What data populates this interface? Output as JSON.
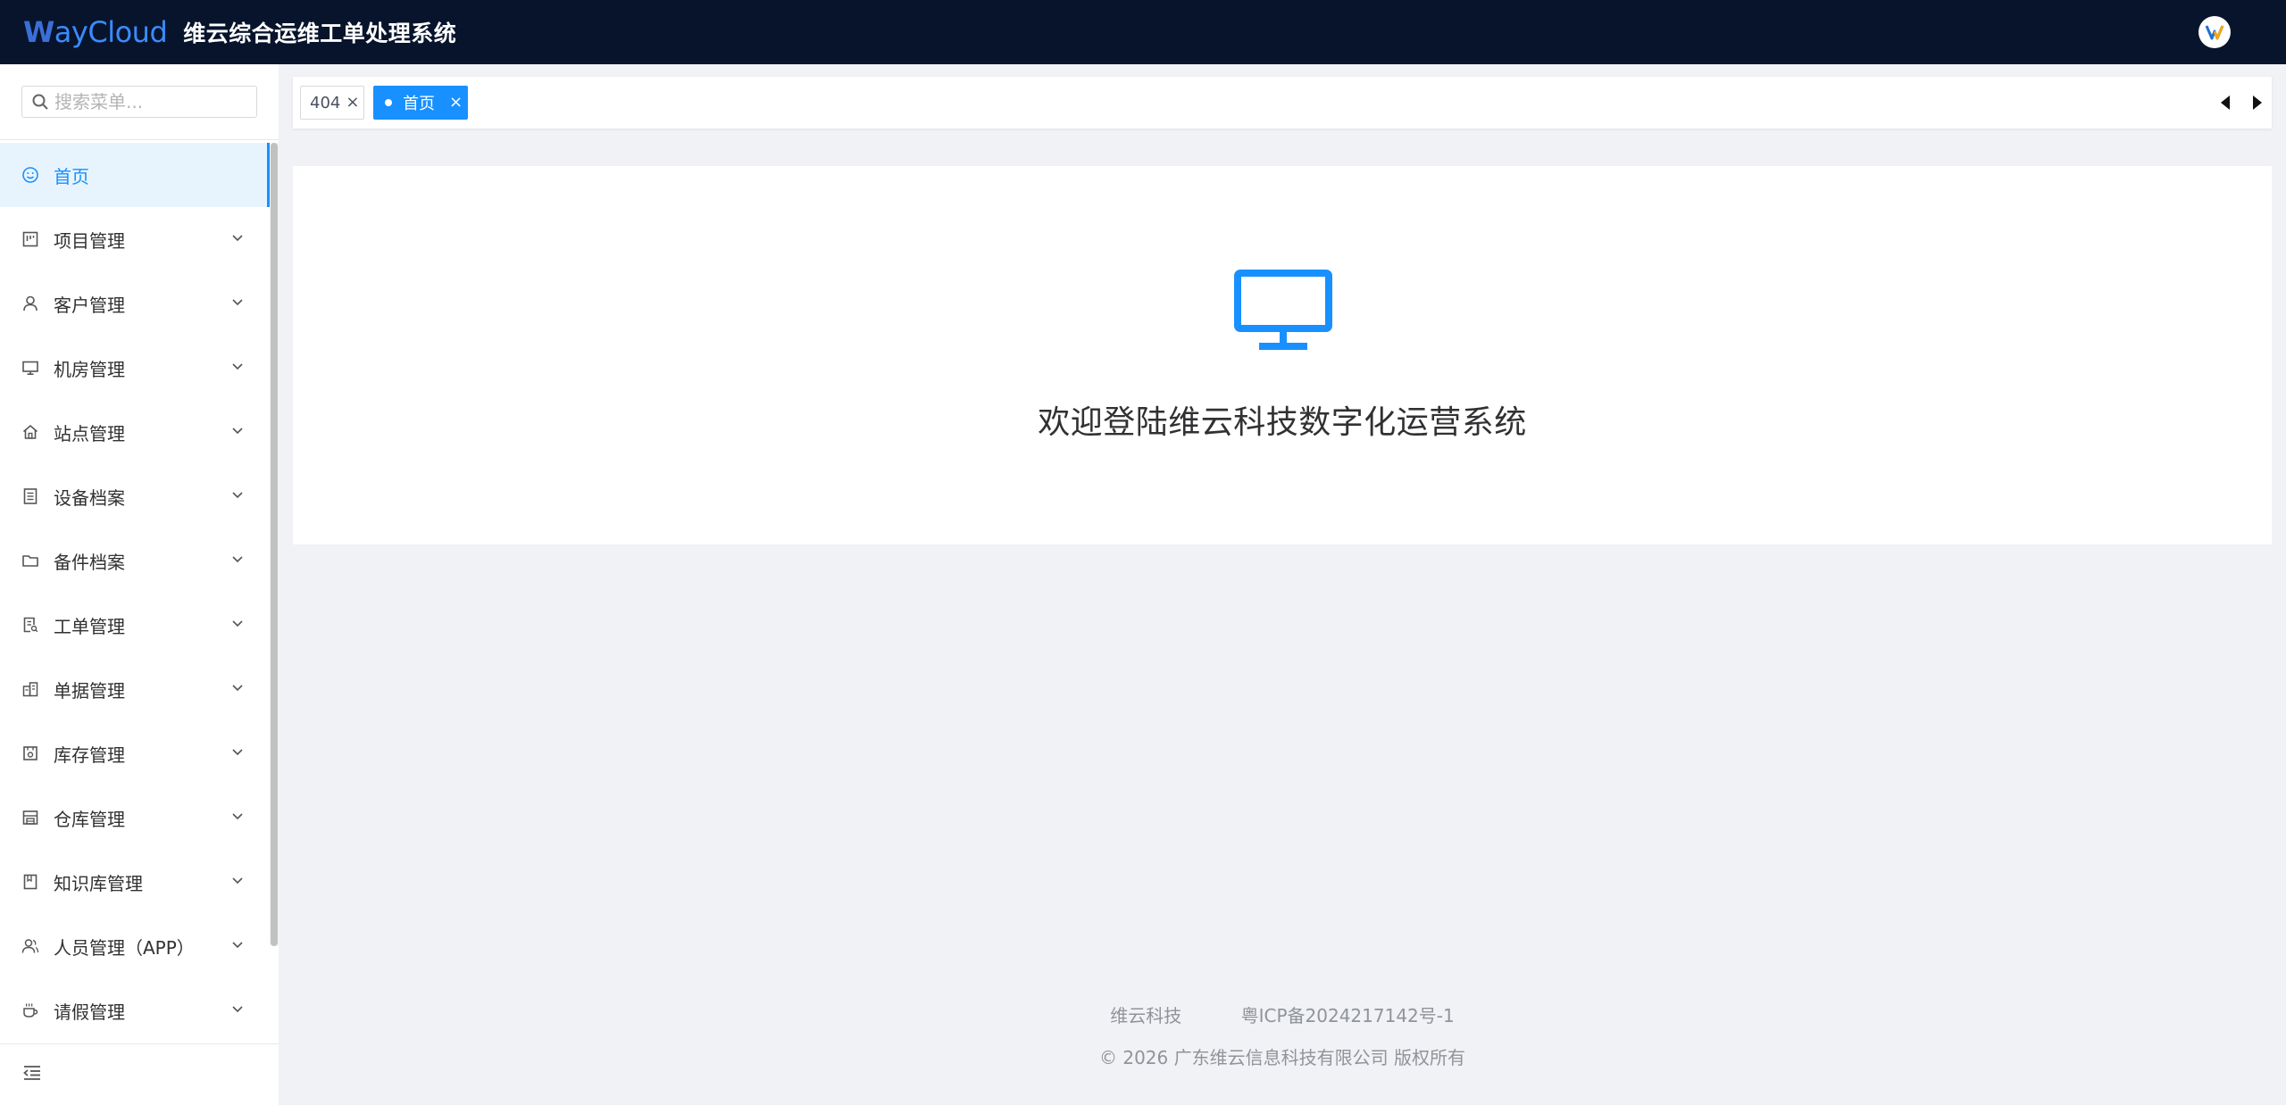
{
  "header": {
    "logo_first": "W",
    "logo_rest": "ayCloud",
    "system_title": "维云综合运维工单处理系统",
    "accent": "#1890ff",
    "background": "#07142b"
  },
  "sidebar": {
    "search_placeholder": "搜索菜单...",
    "items": [
      {
        "label": "首页",
        "icon": "smile-icon",
        "active": true
      },
      {
        "label": "项目管理",
        "icon": "project-icon"
      },
      {
        "label": "客户管理",
        "icon": "user-icon"
      },
      {
        "label": "机房管理",
        "icon": "monitor-icon"
      },
      {
        "label": "站点管理",
        "icon": "home-icon"
      },
      {
        "label": "设备档案",
        "icon": "document-icon"
      },
      {
        "label": "备件档案",
        "icon": "folder-icon"
      },
      {
        "label": "工单管理",
        "icon": "order-icon"
      },
      {
        "label": "单据管理",
        "icon": "building-icon"
      },
      {
        "label": "库存管理",
        "icon": "box-icon"
      },
      {
        "label": "仓库管理",
        "icon": "warehouse-icon"
      },
      {
        "label": "知识库管理",
        "icon": "book-icon"
      },
      {
        "label": "人员管理（APP）",
        "icon": "users-icon"
      },
      {
        "label": "请假管理",
        "icon": "cup-icon"
      }
    ]
  },
  "tabs": [
    {
      "label": "404",
      "active": false
    },
    {
      "label": "首页",
      "active": true
    }
  ],
  "main": {
    "welcome_text": "欢迎登陆维云科技数字化运营系统"
  },
  "footer": {
    "company_short": "维云科技",
    "icp": "粤ICP备2024217142号-1",
    "copyright_symbol": "©",
    "copyright": "2026 广东维云信息科技有限公司 版权所有"
  }
}
